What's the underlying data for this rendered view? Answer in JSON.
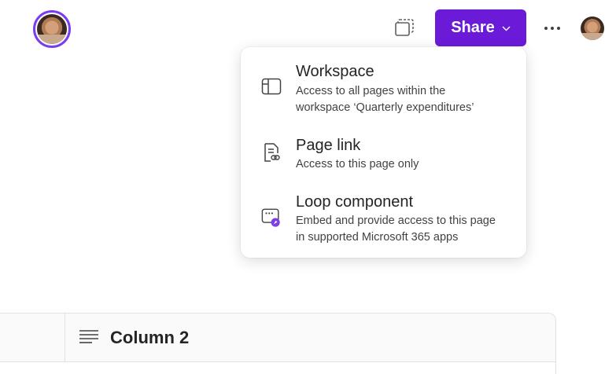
{
  "header": {
    "avatar_left": "user-avatar",
    "present_icon": "present-icon",
    "share_label": "Share",
    "more_icon": "more-icon",
    "avatar_right": "user-avatar"
  },
  "share_menu": {
    "items": [
      {
        "icon": "workspace-icon",
        "title": "Workspace",
        "desc_line1": "Access to all pages within the",
        "desc_line2": "workspace ‘Quarterly expenditures’"
      },
      {
        "icon": "page-link-icon",
        "title": "Page link",
        "desc_line1": "Access to this page only"
      },
      {
        "icon": "loop-component-icon",
        "title": "Loop component",
        "desc_line1": "Embed and provide access to this page",
        "desc_line2": "in supported Microsoft 365 apps"
      }
    ]
  },
  "table": {
    "column2_icon": "text-column-icon",
    "column2_label": "Column 2"
  },
  "colors": {
    "accent": "#6b1bd8",
    "avatar_ring": "#7a3cf0"
  }
}
